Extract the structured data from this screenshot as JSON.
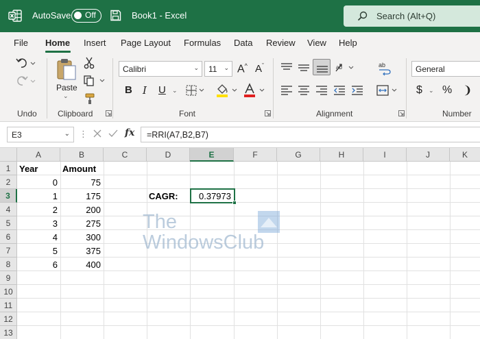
{
  "titlebar": {
    "autosave_label": "AutoSave",
    "toggle_state": "Off",
    "document_title": "Book1  -  Excel",
    "search_placeholder": "Search (Alt+Q)",
    "color": "#1e7145"
  },
  "menu": {
    "tabs": [
      {
        "label": "File"
      },
      {
        "label": "Home",
        "active": true
      },
      {
        "label": "Insert"
      },
      {
        "label": "Page Layout"
      },
      {
        "label": "Formulas"
      },
      {
        "label": "Data"
      },
      {
        "label": "Review"
      },
      {
        "label": "View"
      },
      {
        "label": "Help"
      }
    ]
  },
  "ribbon": {
    "groups": {
      "undo": "Undo",
      "clipboard": "Clipboard",
      "font": "Font",
      "alignment": "Alignment",
      "number": "Number"
    },
    "paste_label": "Paste",
    "font_name": "Calibri",
    "font_size": "11",
    "number_format": "General",
    "format_buttons": {
      "bold": "B",
      "italic": "I",
      "underline": "U"
    },
    "currency_symbol": "$",
    "percent_symbol": "%",
    "comma_symbol": "❩",
    "highlight_color": "#ffe000",
    "font_color": "#e02020"
  },
  "formula_bar": {
    "name_box": "E3",
    "fx_label": "fx",
    "formula": "=RRI(A7,B2,B7)"
  },
  "sheet": {
    "columns": [
      "A",
      "B",
      "C",
      "D",
      "E",
      "F",
      "G",
      "H",
      "I",
      "J",
      "K"
    ],
    "selected_column": "E",
    "rows": [
      "1",
      "2",
      "3",
      "4",
      "5",
      "6",
      "7",
      "8",
      "9",
      "10",
      "11",
      "12",
      "13"
    ],
    "selected_row": "3",
    "headers": {
      "A1": "Year",
      "B1": "Amount"
    },
    "years": [
      "0",
      "1",
      "2",
      "3",
      "4",
      "5",
      "6"
    ],
    "amounts": [
      "75",
      "175",
      "200",
      "275",
      "300",
      "375",
      "400"
    ],
    "cagr_label": "CAGR:",
    "cagr_value": "0.37973",
    "active_cell": "E3"
  },
  "watermark": {
    "line1": "The",
    "line2": "WindowsClub"
  }
}
